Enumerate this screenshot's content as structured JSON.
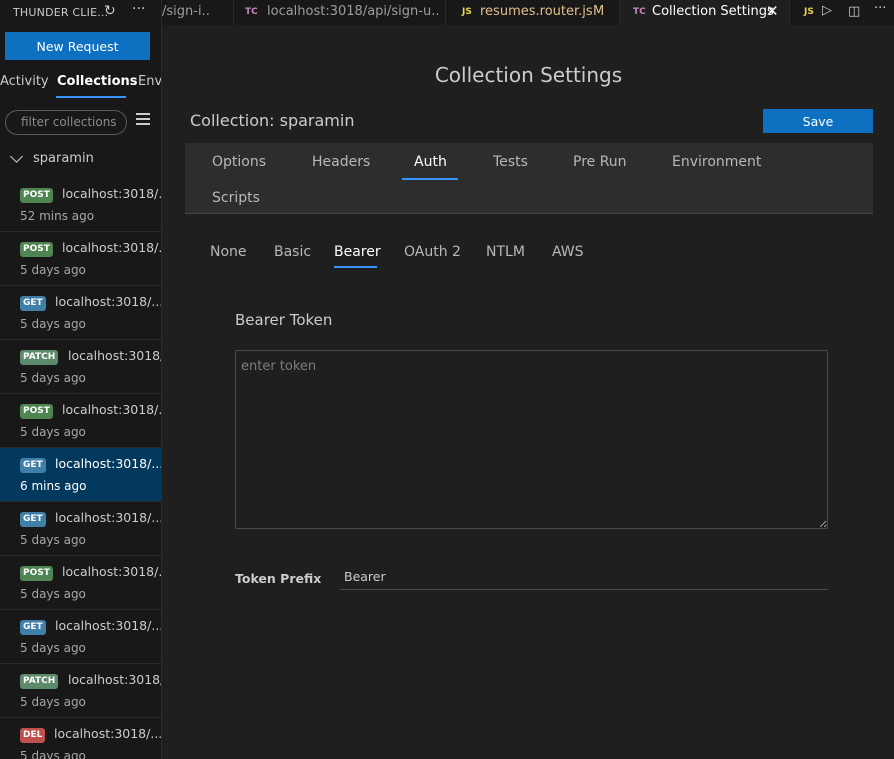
{
  "sidebar": {
    "title": "THUNDER CLIE...",
    "new_request_label": "New Request",
    "tabs": [
      "Activity",
      "Collections",
      "Env"
    ],
    "active_tab": "Collections",
    "filter_placeholder": "filter collections",
    "collection_name": "sparamin",
    "requests": [
      {
        "method": "POST",
        "url": "localhost:3018/...",
        "time": "52 mins ago",
        "selected": false
      },
      {
        "method": "POST",
        "url": "localhost:3018/...",
        "time": "5 days ago",
        "selected": false
      },
      {
        "method": "GET",
        "url": "localhost:3018/...",
        "time": "5 days ago",
        "selected": false
      },
      {
        "method": "PATCH",
        "url": "localhost:3018/...",
        "time": "5 days ago",
        "selected": false
      },
      {
        "method": "POST",
        "url": "localhost:3018/...",
        "time": "5 days ago",
        "selected": false
      },
      {
        "method": "GET",
        "url": "localhost:3018/...",
        "time": "6 mins ago",
        "selected": true
      },
      {
        "method": "GET",
        "url": "localhost:3018/...",
        "time": "5 days ago",
        "selected": false
      },
      {
        "method": "POST",
        "url": "localhost:3018/...",
        "time": "5 days ago",
        "selected": false
      },
      {
        "method": "GET",
        "url": "localhost:3018/...",
        "time": "5 days ago",
        "selected": false
      },
      {
        "method": "PATCH",
        "url": "localhost:3018/...",
        "time": "5 days ago",
        "selected": false
      },
      {
        "method": "DEL",
        "url": "localhost:3018/...",
        "time": "5 days ago",
        "selected": false
      }
    ]
  },
  "editor_tabs": [
    {
      "lang": "",
      "label": "/sign-i..",
      "modified": "",
      "active": false
    },
    {
      "lang": "TC",
      "label": "localhost:3018/api/sign-u..",
      "modified": "",
      "active": false
    },
    {
      "lang": "JS",
      "label": "resumes.router.js",
      "modified": "M",
      "active": false
    },
    {
      "lang": "TC",
      "label": "Collection Settings",
      "modified": "",
      "active": true
    },
    {
      "lang": "JS",
      "label": "",
      "modified": "",
      "active": false
    }
  ],
  "main": {
    "page_title": "Collection Settings",
    "collection_title": "Collection: sparamin",
    "save_label": "Save",
    "settings_tabs": [
      "Options",
      "Headers",
      "Auth",
      "Tests",
      "Pre Run",
      "Environment",
      "Scripts"
    ],
    "active_settings_tab": "Auth",
    "auth_tabs": [
      "None",
      "Basic",
      "Bearer",
      "OAuth 2",
      "NTLM",
      "AWS"
    ],
    "active_auth_tab": "Bearer",
    "bearer_token_label": "Bearer Token",
    "token_placeholder": "enter token",
    "token_value": "",
    "token_prefix_label": "Token Prefix",
    "token_prefix_value": "Bearer"
  },
  "colors": {
    "accent": "#0e70c0",
    "tab_underline": "#3794ff",
    "selected_row": "#04395e",
    "post_badge": "#4e8552",
    "get_badge": "#3f7fa8",
    "del_badge": "#c0504d"
  },
  "icons": {
    "refresh": "refresh-icon",
    "more": "more-icon",
    "menu": "menu-icon",
    "close": "close-icon",
    "run": "run-icon",
    "split": "split-editor-icon"
  }
}
